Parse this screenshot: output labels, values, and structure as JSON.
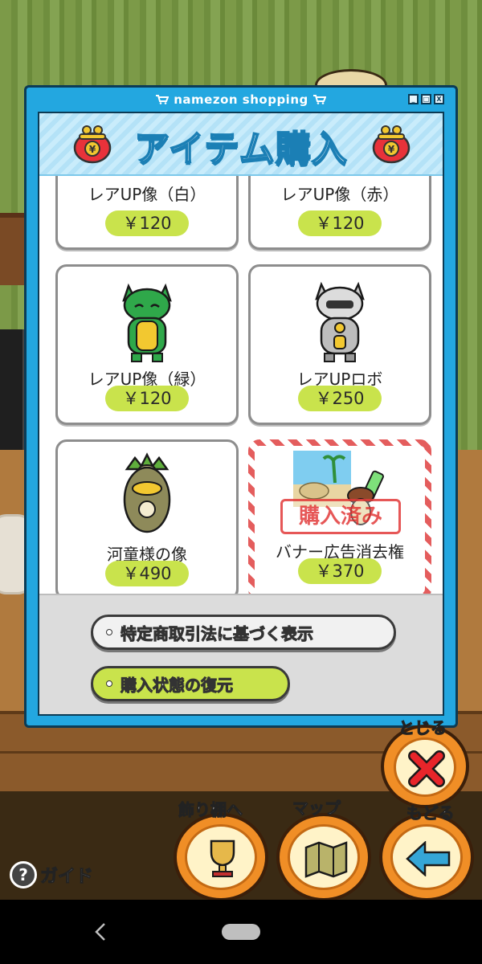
{
  "window": {
    "title": "namezon shopping",
    "controls": [
      "_",
      "□",
      "X"
    ]
  },
  "header": {
    "title": "アイテム購入"
  },
  "items": [
    {
      "name": "レアUP像（白）",
      "price": "￥120"
    },
    {
      "name": "レアUP像（赤）",
      "price": "￥120"
    },
    {
      "name": "レアUP像（緑）",
      "price": "￥120"
    },
    {
      "name": "レアUPロボ",
      "price": "￥250"
    },
    {
      "name": "河童様の像",
      "price": "￥490"
    },
    {
      "name": "バナー広告消去権",
      "price": "￥370",
      "stamp": "購入済み"
    }
  ],
  "buttons": {
    "legal": "特定商取引法に基づく表示",
    "restore": "購入状態の復元"
  },
  "game_ui": {
    "close_label": "とじる",
    "shelf_label": "飾り棚へ",
    "map_label": "マップ",
    "back_label": "もどる",
    "guide_label": "ガイド",
    "guide_icon": "?"
  },
  "colors": {
    "window_blue": "#23a7e0",
    "price_green": "#c9e34c",
    "close_orange": "#f08e26",
    "stamp_red": "#e23a3a"
  }
}
